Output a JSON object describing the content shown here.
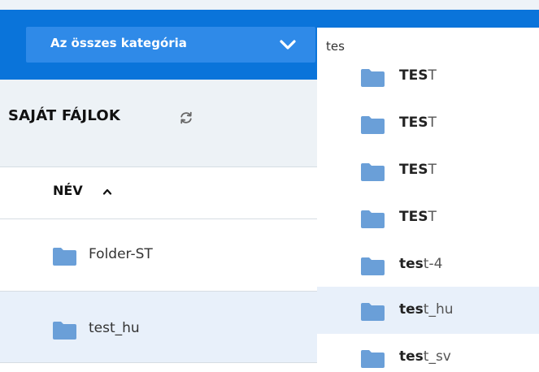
{
  "header": {
    "category_select": {
      "label": "Az összes kategória",
      "icon": "chevron-down-icon"
    },
    "search": {
      "value": "tes",
      "placeholder": ""
    }
  },
  "section": {
    "title": "SAJÁT FÁJLOK",
    "refresh_icon": "refresh-icon"
  },
  "table": {
    "column_header": "NÉV",
    "sort_icon": "chevron-up-icon",
    "rows": [
      {
        "name": "Folder-ST",
        "icon": "folder-icon"
      },
      {
        "name": "test_hu",
        "icon": "folder-icon",
        "selected": true
      }
    ]
  },
  "search_results": [
    {
      "match": "TES",
      "rest": "T",
      "icon": "folder-icon"
    },
    {
      "match": "TES",
      "rest": "T",
      "icon": "folder-icon"
    },
    {
      "match": "TES",
      "rest": "T",
      "icon": "folder-icon"
    },
    {
      "match": "TES",
      "rest": "T",
      "icon": "folder-icon"
    },
    {
      "match": "tes",
      "rest": "t-4",
      "icon": "folder-icon"
    },
    {
      "match": "tes",
      "rest": "t_hu",
      "icon": "folder-icon",
      "highlighted": true
    },
    {
      "match": "tes",
      "rest": "t_sv",
      "icon": "folder-icon"
    }
  ],
  "colors": {
    "accent": "#0a74da",
    "accent_light": "#2f8ae8",
    "folder": "#6a9fd8",
    "row_selected": "#e8f0fa",
    "header_bg": "#edf2f6"
  }
}
